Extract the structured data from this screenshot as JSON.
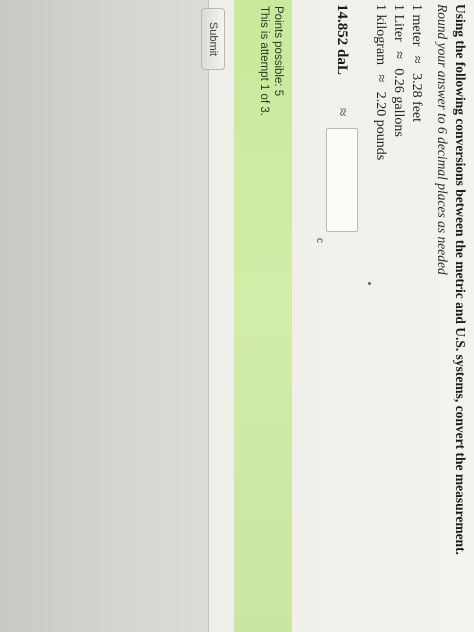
{
  "question": {
    "title": "Using the following conversions between the metric and U.S. systems, convert the measurement.",
    "instruction": "Round your answer to 6 decimal places as needed",
    "conversions": [
      {
        "left": "1 meter",
        "symbol": "≈",
        "right": "3.28 feet"
      },
      {
        "left": "1 Liter",
        "symbol": "≈",
        "right": "0.26 gallons"
      },
      {
        "left": "1 kilogram",
        "symbol": "≈",
        "right": "2.20 pounds"
      }
    ],
    "given": "14.852 daL",
    "given_symbol": "≈",
    "answer_value": "",
    "answer_marker": "c"
  },
  "status": {
    "points_possible": "Points possible: 5",
    "attempt": "This is attempt 1 of 3."
  },
  "actions": {
    "submit_label": "Submit"
  }
}
